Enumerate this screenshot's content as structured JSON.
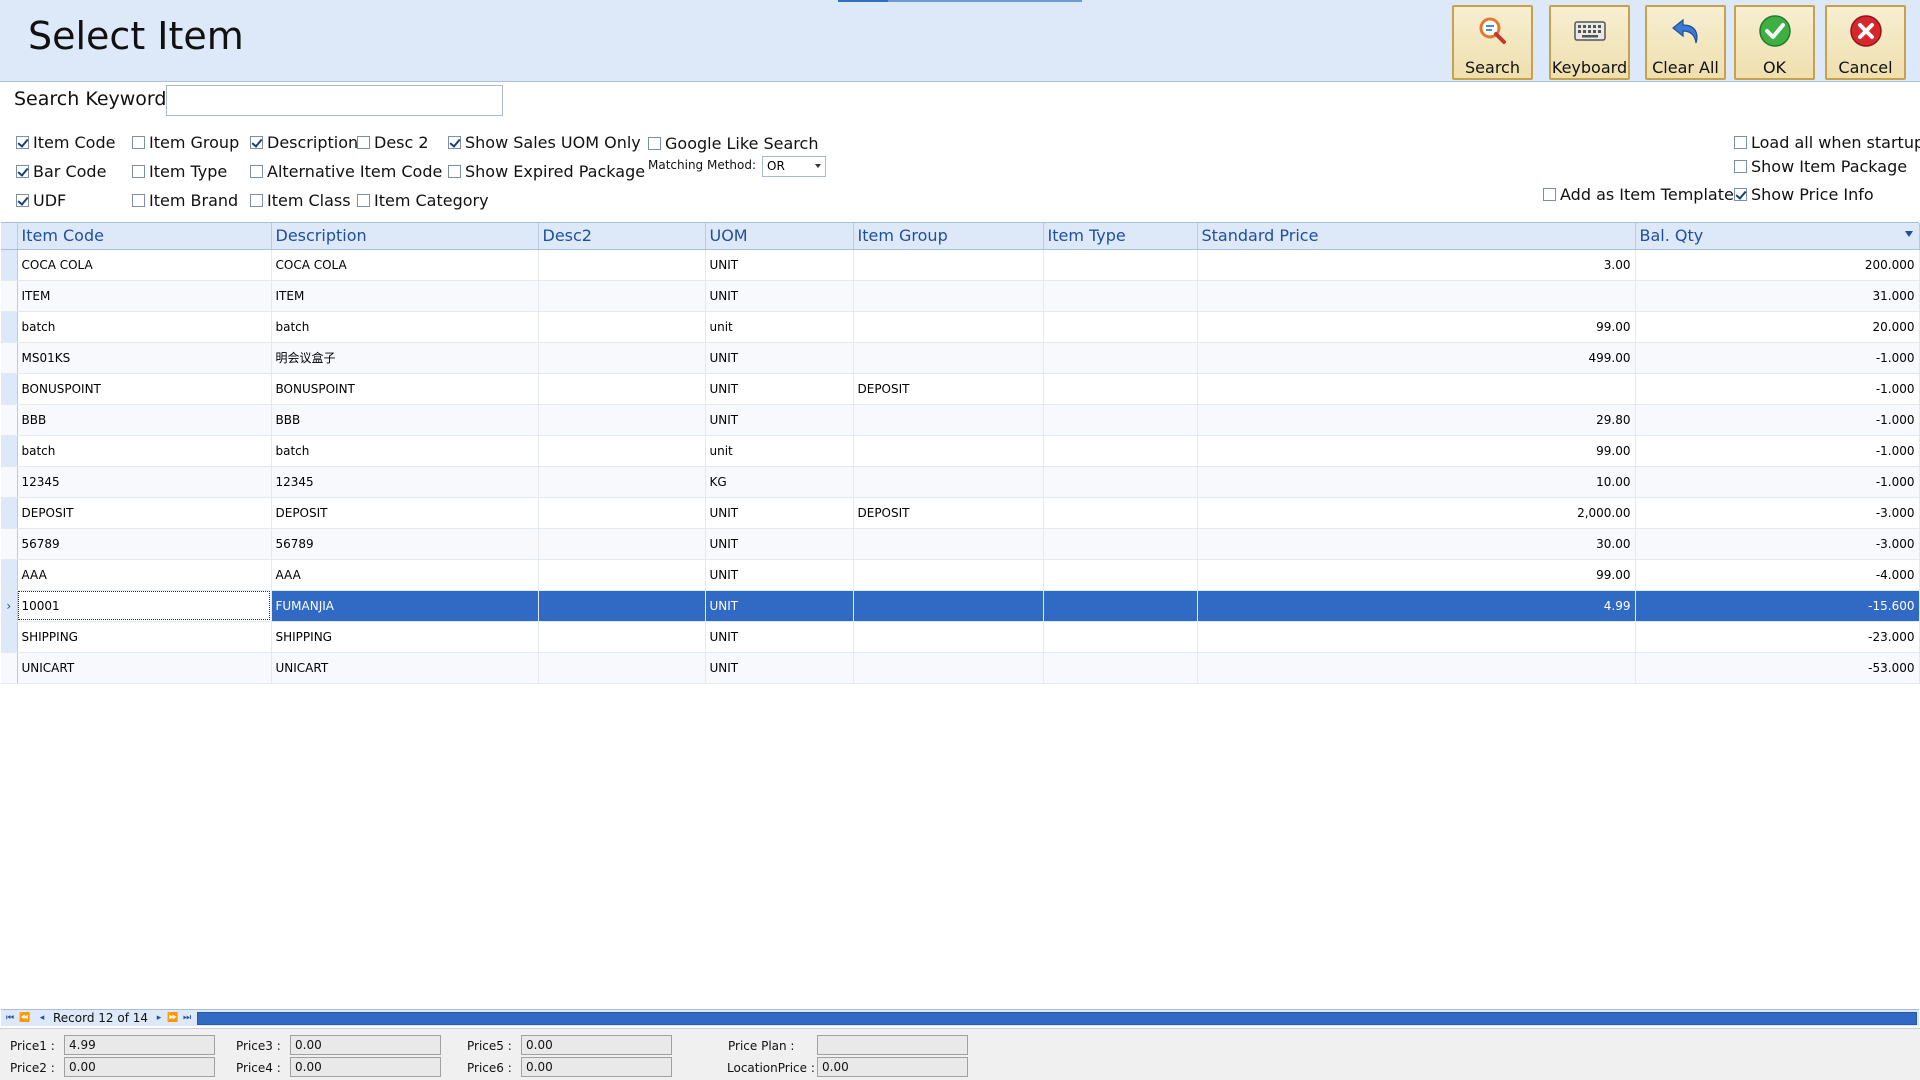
{
  "header": {
    "title": "Select Item",
    "buttons": [
      {
        "label": "Search",
        "icon": "search-icon"
      },
      {
        "label": "Keyboard",
        "icon": "keyboard-icon"
      },
      {
        "label": "Clear All",
        "icon": "undo-icon"
      },
      {
        "label": "OK",
        "icon": "check-icon"
      },
      {
        "label": "Cancel",
        "icon": "close-icon"
      }
    ]
  },
  "search": {
    "label": "Search Keyword",
    "value": ""
  },
  "options": {
    "item_code": "Item Code",
    "bar_code": "Bar Code",
    "udf": "UDF",
    "item_group": "Item Group",
    "item_type": "Item Type",
    "item_brand": "Item Brand",
    "description": "Description",
    "alternative_item_code": "Alternative Item Code",
    "item_class": "Item Class",
    "desc2": "Desc 2",
    "item_category": "Item Category",
    "show_sales_uom_only": "Show Sales UOM Only",
    "show_expired_package": "Show Expired Package",
    "google_like_search": "Google Like Search",
    "matching_method_label": "Matching Method:",
    "matching_method_value": "OR",
    "load_all_when_startup": "Load all when startup",
    "show_item_package": "Show Item Package",
    "add_as_item_template": "Add as Item Template",
    "show_price_info": "Show Price Info"
  },
  "grid": {
    "columns": [
      "Item Code",
      "Description",
      "Desc2",
      "UOM",
      "Item Group",
      "Item Type",
      "Standard Price",
      "Bal. Qty"
    ],
    "rows": [
      [
        "COCA COLA",
        "COCA COLA",
        "",
        "UNIT",
        "",
        "",
        "3.00",
        "200.000"
      ],
      [
        "ITEM",
        "ITEM",
        "",
        "UNIT",
        "",
        "",
        "",
        "31.000"
      ],
      [
        "batch",
        "batch",
        "",
        "unit",
        "",
        "",
        "99.00",
        "20.000"
      ],
      [
        "MS01KS",
        "明会议盒子",
        "",
        "UNIT",
        "",
        "",
        "499.00",
        "-1.000"
      ],
      [
        "BONUSPOINT",
        "BONUSPOINT",
        "",
        "UNIT",
        "DEPOSIT",
        "",
        "",
        "-1.000"
      ],
      [
        "BBB",
        "BBB",
        "",
        "UNIT",
        "",
        "",
        "29.80",
        "-1.000"
      ],
      [
        "batch",
        "batch",
        "",
        "unit",
        "",
        "",
        "99.00",
        "-1.000"
      ],
      [
        "12345",
        "12345",
        "",
        "KG",
        "",
        "",
        "10.00",
        "-1.000"
      ],
      [
        "DEPOSIT",
        "DEPOSIT",
        "",
        "UNIT",
        "DEPOSIT",
        "",
        "2,000.00",
        "-3.000"
      ],
      [
        "56789",
        "56789",
        "",
        "UNIT",
        "",
        "",
        "30.00",
        "-3.000"
      ],
      [
        "AAA",
        "AAA",
        "",
        "UNIT",
        "",
        "",
        "99.00",
        "-4.000"
      ],
      [
        "10001",
        "FUMANJIA",
        "",
        "UNIT",
        "",
        "",
        "4.99",
        "-15.600"
      ],
      [
        "SHIPPING",
        "SHIPPING",
        "",
        "UNIT",
        "",
        "",
        "",
        "-23.000"
      ],
      [
        "UNICART",
        "UNICART",
        "",
        "UNIT",
        "",
        "",
        "",
        "-53.000"
      ]
    ],
    "selected_index": 11
  },
  "navigator": {
    "record_text": "Record 12 of 14"
  },
  "prices": {
    "price1_label": "Price1 :",
    "price1": "4.99",
    "price2_label": "Price2 :",
    "price2": "0.00",
    "price3_label": "Price3 :",
    "price3": "0.00",
    "price4_label": "Price4 :",
    "price4": "0.00",
    "price5_label": "Price5 :",
    "price5": "0.00",
    "price6_label": "Price6 :",
    "price6": "0.00",
    "price_plan_label": "Price Plan :",
    "price_plan": "",
    "location_price_label": "LocationPrice :",
    "location_price": "0.00"
  },
  "colors": {
    "selection": "#316ac5",
    "header_bg": "#dde9f8",
    "column_header_text": "#1f4fa0",
    "button_border": "#c8a24a"
  }
}
